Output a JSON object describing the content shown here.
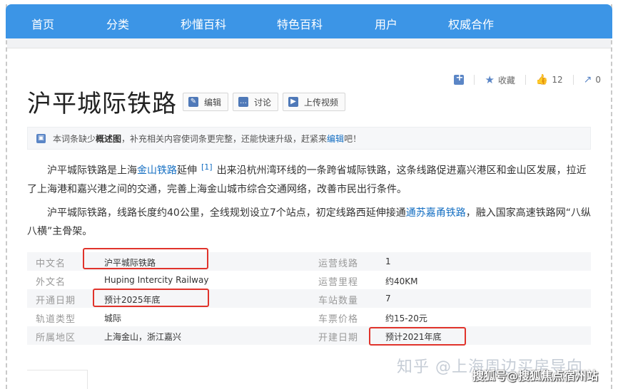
{
  "nav": {
    "items": [
      "首页",
      "分类",
      "秒懂百科",
      "特色百科",
      "用户",
      "权威合作"
    ],
    "bg_color": "#3c95e6"
  },
  "actions": {
    "collect_label": "收藏",
    "like_count": "12",
    "share_count": "0"
  },
  "page": {
    "title": "沪平城际铁路",
    "edit_label": "编辑",
    "discuss_label": "讨论",
    "upload_video_label": "上传视频"
  },
  "notice": {
    "text_prefix": "本词条缺少",
    "highlight": "概述图",
    "text_middle": "，补充相关内容使词条更完整，还能快速升级，赶紧来",
    "link": "编辑",
    "text_suffix": "吧！"
  },
  "intro": {
    "p1_a": "沪平城际铁路是上海",
    "p1_link": "金山铁路",
    "p1_b": "延伸",
    "p1_ref": "[1]",
    "p1_c": "出来沿杭州湾环线的一条跨省城际铁路，这条线路促进嘉兴港区和金山区发展，拉近了上海港和嘉兴港之间的交通，完善上海金山城市综合交通网络，改善市民出行条件。",
    "p2_a": "沪平城际铁路，线路长度约40公里，全线规划设立7个站点，初定线路西延伸接通",
    "p2_link": "通苏嘉甬铁路",
    "p2_b": "，融入国家高速铁路网“八纵八横”主骨架。"
  },
  "basic_info": {
    "left": [
      {
        "label": "中文名",
        "value": "沪平城际铁路"
      },
      {
        "label": "外文名",
        "value": "Huping Intercity Railway"
      },
      {
        "label": "开通日期",
        "value": "预计2025年底"
      },
      {
        "label": "轨道类型",
        "value": "城际"
      },
      {
        "label": "所属地区",
        "value": "上海金山，浙江嘉兴"
      }
    ],
    "right": [
      {
        "label": "运营线路",
        "value": "1"
      },
      {
        "label": "运营里程",
        "value": "约40KM"
      },
      {
        "label": "车站数量",
        "value": "7"
      },
      {
        "label": "车票价格",
        "value": "约15-20元"
      },
      {
        "label": "开建日期",
        "value": "预计2021年底"
      }
    ]
  },
  "watermarks": {
    "zhihu": "知乎 @上海周边买房导向",
    "sohu": "搜狐号@搜狐焦点宿州站"
  }
}
